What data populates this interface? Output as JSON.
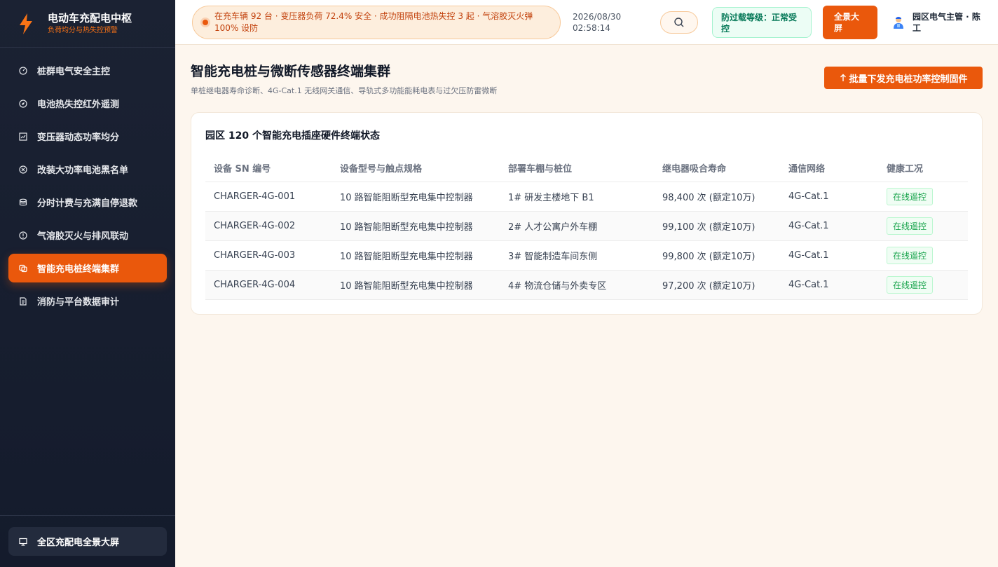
{
  "brand": {
    "title": "电动车充配电中枢",
    "subtitle": "负荷均分与热失控预警"
  },
  "nav": {
    "items": [
      {
        "label": "桩群电气安全主控",
        "icon": "gauge-icon"
      },
      {
        "label": "电池热失控红外遥测",
        "icon": "compass-icon"
      },
      {
        "label": "变压器动态功率均分",
        "icon": "chart-icon"
      },
      {
        "label": "改装大功率电池黑名单",
        "icon": "ban-icon"
      },
      {
        "label": "分时计费与充满自停退款",
        "icon": "database-icon"
      },
      {
        "label": "气溶胶灭火与排风联动",
        "icon": "alert-icon"
      },
      {
        "label": "智能充电桩终端集群",
        "icon": "chip-icon",
        "active": true
      },
      {
        "label": "消防与平台数据审计",
        "icon": "document-icon"
      }
    ],
    "footer_label": "全区充配电全景大屏"
  },
  "topbar": {
    "ticker": "在充车辆 92 台 · 变压器负荷 72.4% 安全 · 成功阻隔电池热失控 3 起 · 气溶胶灭火弹 100% 设防",
    "date": "2026/08/30",
    "time": "02:58:14",
    "safety": "防过载等级：正常受控",
    "fullscreen": "全景大屏",
    "user": "园区电气主管 · 陈工"
  },
  "page": {
    "title": "智能充电桩与微断传感器终端集群",
    "subtitle": "单桩继电器寿命诊断、4G-Cat.1 无线网关通信、导轨式多功能能耗电表与过欠压防雷微断",
    "batch_button": "批量下发充电桩功率控制固件"
  },
  "card": {
    "title": "园区 120 个智能充电插座硬件终端状态",
    "columns": [
      "设备 SN 编号",
      "设备型号与触点规格",
      "部署车棚与桩位",
      "继电器吸合寿命",
      "通信网络",
      "健康工况"
    ],
    "rows": [
      {
        "sn": "CHARGER-4G-001",
        "model": "10 路智能阻断型充电集中控制器",
        "location": "1# 研发主楼地下 B1",
        "life": "98,400 次 (额定10万)",
        "network": "4G-Cat.1",
        "status": "在线遥控"
      },
      {
        "sn": "CHARGER-4G-002",
        "model": "10 路智能阻断型充电集中控制器",
        "location": "2# 人才公寓户外车棚",
        "life": "99,100 次 (额定10万)",
        "network": "4G-Cat.1",
        "status": "在线遥控"
      },
      {
        "sn": "CHARGER-4G-003",
        "model": "10 路智能阻断型充电集中控制器",
        "location": "3# 智能制造车间东侧",
        "life": "99,800 次 (额定10万)",
        "network": "4G-Cat.1",
        "status": "在线遥控"
      },
      {
        "sn": "CHARGER-4G-004",
        "model": "10 路智能阻断型充电集中控制器",
        "location": "4# 物流仓储与外卖专区",
        "life": "97,200 次 (额定10万)",
        "network": "4G-Cat.1",
        "status": "在线遥控"
      }
    ]
  },
  "colors": {
    "accent": "#ea580c",
    "sidebar": "#1b2233",
    "success": "#16a34a"
  }
}
